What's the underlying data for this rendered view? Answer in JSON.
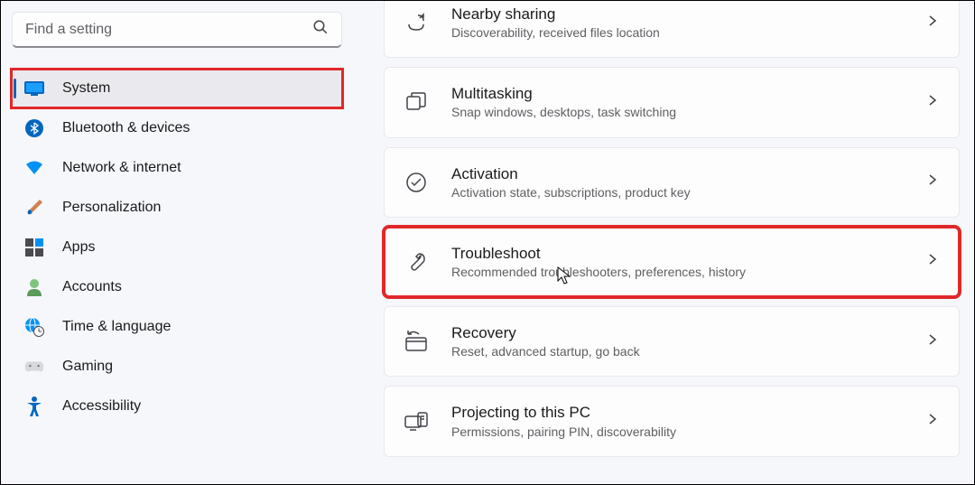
{
  "search": {
    "placeholder": "Find a setting"
  },
  "nav": {
    "items": [
      {
        "label": "System"
      },
      {
        "label": "Bluetooth & devices"
      },
      {
        "label": "Network & internet"
      },
      {
        "label": "Personalization"
      },
      {
        "label": "Apps"
      },
      {
        "label": "Accounts"
      },
      {
        "label": "Time & language"
      },
      {
        "label": "Gaming"
      },
      {
        "label": "Accessibility"
      }
    ]
  },
  "cards": [
    {
      "title": "Nearby sharing",
      "desc": "Discoverability, received files location"
    },
    {
      "title": "Multitasking",
      "desc": "Snap windows, desktops, task switching"
    },
    {
      "title": "Activation",
      "desc": "Activation state, subscriptions, product key"
    },
    {
      "title": "Troubleshoot",
      "desc": "Recommended troubleshooters, preferences, history"
    },
    {
      "title": "Recovery",
      "desc": "Reset, advanced startup, go back"
    },
    {
      "title": "Projecting to this PC",
      "desc": "Permissions, pairing PIN, discoverability"
    }
  ]
}
